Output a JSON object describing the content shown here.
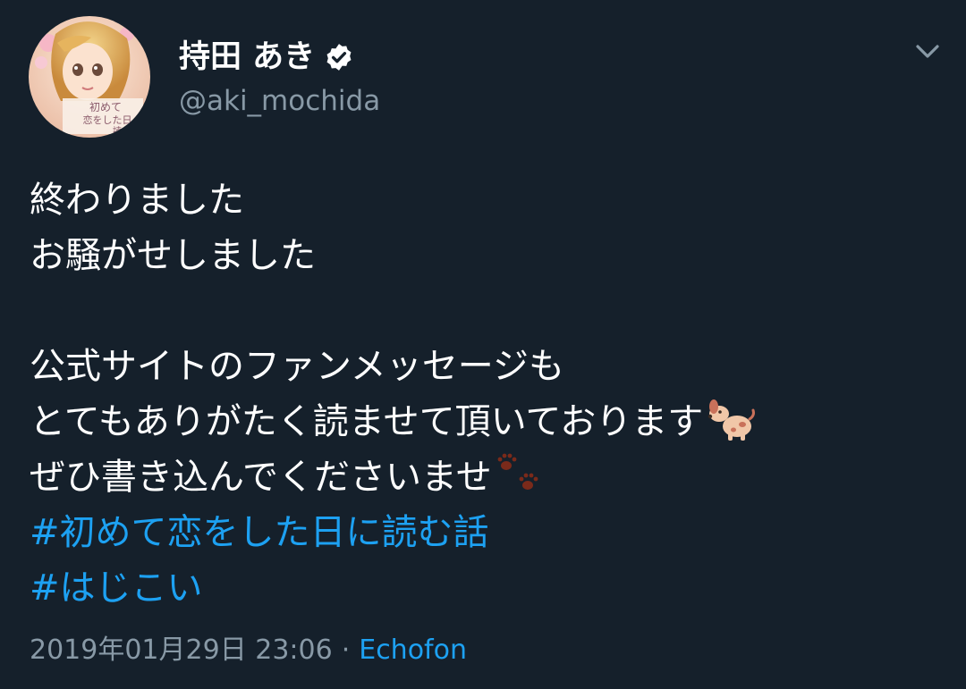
{
  "author": {
    "display_name": "持田 あき",
    "handle": "@aki_mochida",
    "verified": true,
    "avatar_cover_text": "初めて恋をした日に読む話"
  },
  "tweet": {
    "lines": [
      "終わりました",
      "お騒がせしました",
      "",
      "公式サイトのファンメッセージも",
      "とてもありがたく読ませて頂いております",
      "ぜひ書き込んでくださいませ"
    ],
    "emoji_line5": "dog-emoji",
    "emoji_line6": "paw-prints-emoji",
    "hashtags": [
      "#初めて恋をした日に読む話",
      "#はじこい"
    ]
  },
  "meta": {
    "timestamp": "2019年01月29日 23:06",
    "separator": "·",
    "source": "Echofon"
  },
  "colors": {
    "background": "#15202b",
    "text": "#ffffff",
    "secondary": "#8899a6",
    "link": "#1da1f2"
  }
}
